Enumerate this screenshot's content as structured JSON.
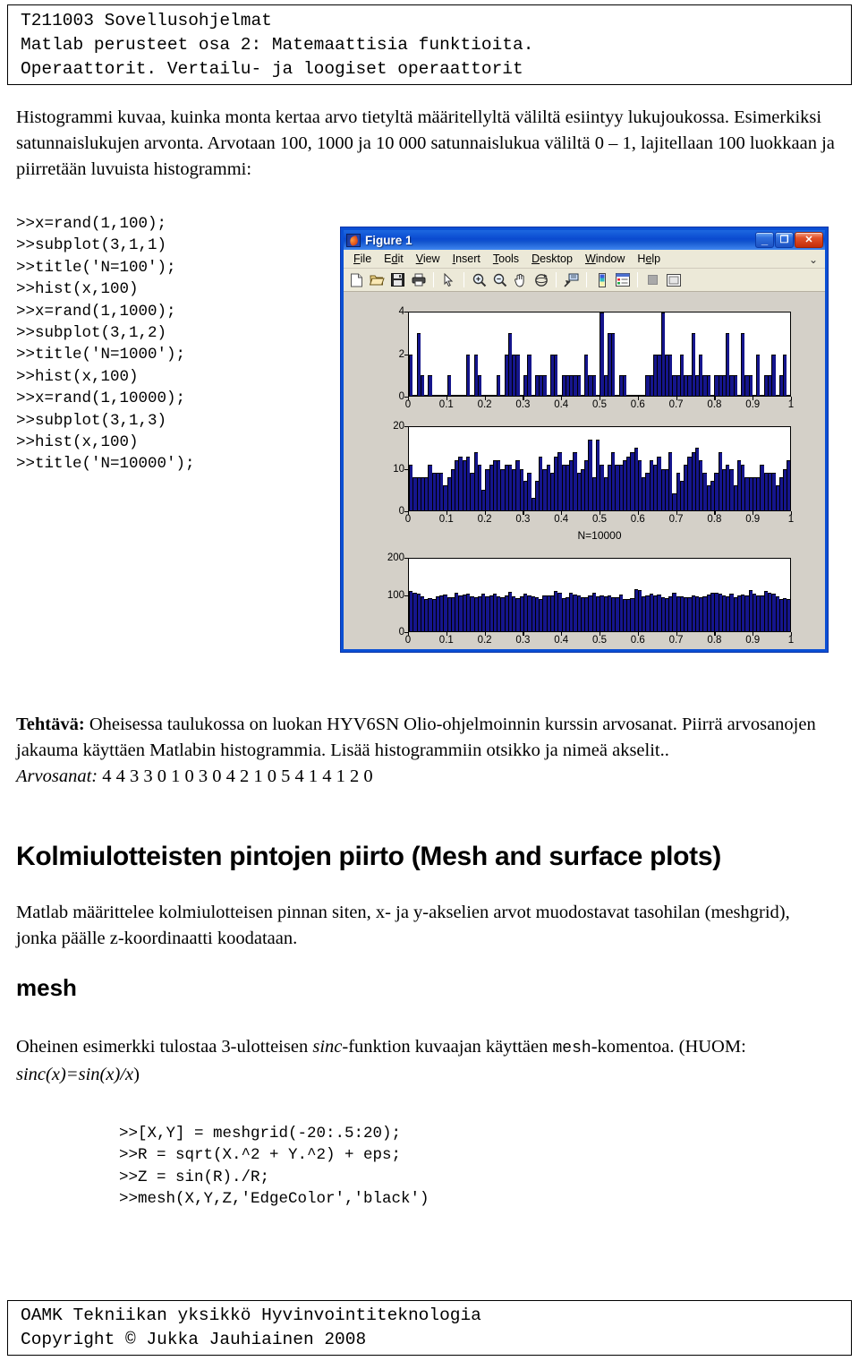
{
  "header": {
    "line1": "T211003 Sovellusohjelmat",
    "line2": "Matlab perusteet osa 2: Matemaattisia funktioita.",
    "line3": "Operaattorit. Vertailu- ja loogiset operaattorit"
  },
  "intro": {
    "text": "Histogrammi kuvaa, kuinka monta kertaa arvo tietyltä määritellyltä väliltä esiintyy lukujoukossa. Esimerkiksi satunnaislukujen arvonta. Arvotaan 100, 1000 ja 10 000 satunnaislukua väliltä 0 – 1, lajitellaan 100 luokkaan ja piirretään luvuista histogrammi:"
  },
  "code_block_1": {
    "text": ">>x=rand(1,100);\n>>subplot(3,1,1)\n>>title('N=100');\n>>hist(x,100)\n>>x=rand(1,1000);\n>>subplot(3,1,2)\n>>title('N=1000');\n>>hist(x,100)\n>>x=rand(1,10000);\n>>subplot(3,1,3)\n>>hist(x,100)\n>>title('N=10000');"
  },
  "figure_window": {
    "title": "Figure 1",
    "icon": "matlab-icon",
    "window_buttons": [
      {
        "name": "minimize-button",
        "glyph": "_"
      },
      {
        "name": "maximize-button",
        "glyph": "❐"
      },
      {
        "name": "close-button",
        "glyph": "✕"
      }
    ],
    "menu": [
      {
        "label": "File",
        "accel": "F"
      },
      {
        "label": "Edit",
        "accel": "E"
      },
      {
        "label": "View",
        "accel": "V"
      },
      {
        "label": "Insert",
        "accel": "I"
      },
      {
        "label": "Tools",
        "accel": "T"
      },
      {
        "label": "Desktop",
        "accel": "D"
      },
      {
        "label": "Window",
        "accel": "W"
      },
      {
        "label": "Help",
        "accel": "H"
      }
    ],
    "menu_overflow": "⌄",
    "toolbar": [
      {
        "name": "new-figure-icon"
      },
      {
        "name": "open-file-icon"
      },
      {
        "name": "save-figure-icon"
      },
      {
        "name": "print-figure-icon"
      },
      {
        "name": "separator"
      },
      {
        "name": "edit-plot-pointer-icon"
      },
      {
        "name": "separator"
      },
      {
        "name": "zoom-in-icon"
      },
      {
        "name": "zoom-out-icon"
      },
      {
        "name": "pan-icon"
      },
      {
        "name": "rotate-3d-icon"
      },
      {
        "name": "separator"
      },
      {
        "name": "data-cursor-icon"
      },
      {
        "name": "separator"
      },
      {
        "name": "insert-colorbar-icon"
      },
      {
        "name": "insert-legend-icon"
      },
      {
        "name": "separator"
      },
      {
        "name": "hide-plot-tools-icon"
      },
      {
        "name": "show-plot-tools-icon"
      }
    ]
  },
  "chart_data": [
    {
      "type": "bar",
      "title": "",
      "xlabel": "",
      "ylabel": "",
      "xlim": [
        0,
        1
      ],
      "ylim": [
        0,
        4
      ],
      "xticks": [
        "0",
        "0.1",
        "0.2",
        "0.3",
        "0.4",
        "0.5",
        "0.6",
        "0.7",
        "0.8",
        "0.9",
        "1"
      ],
      "yticks": [
        "0",
        "2",
        "4"
      ],
      "bin_count": 100,
      "values": [
        2,
        0,
        3,
        1,
        0,
        1,
        0,
        0,
        0,
        0,
        1,
        0,
        0,
        0,
        0,
        2,
        0,
        2,
        1,
        0,
        0,
        0,
        0,
        1,
        0,
        2,
        3,
        2,
        2,
        0,
        1,
        2,
        0,
        1,
        1,
        1,
        0,
        2,
        2,
        0,
        1,
        1,
        1,
        1,
        1,
        0,
        2,
        1,
        1,
        0,
        4,
        1,
        3,
        3,
        0,
        1,
        1,
        0,
        0,
        0,
        0,
        0,
        1,
        1,
        2,
        2,
        4,
        2,
        2,
        1,
        1,
        2,
        1,
        1,
        3,
        1,
        2,
        1,
        1,
        0,
        1,
        1,
        1,
        3,
        1,
        1,
        0,
        3,
        1,
        1,
        0,
        2,
        0,
        1,
        1,
        2,
        0,
        1,
        2,
        0
      ],
      "grid": false
    },
    {
      "type": "bar",
      "title": "",
      "xlabel": "N=10000",
      "ylabel": "",
      "xlim": [
        0,
        1
      ],
      "ylim": [
        0,
        20
      ],
      "xticks": [
        "0",
        "0.1",
        "0.2",
        "0.3",
        "0.4",
        "0.5",
        "0.6",
        "0.7",
        "0.8",
        "0.9",
        "1"
      ],
      "yticks": [
        "0",
        "10",
        "20"
      ],
      "bin_count": 100,
      "values": [
        11,
        8,
        8,
        8,
        8,
        11,
        9,
        9,
        9,
        6,
        8,
        10,
        12,
        13,
        12,
        13,
        9,
        14,
        11,
        5,
        10,
        11,
        12,
        12,
        10,
        11,
        11,
        10,
        12,
        10,
        7,
        9,
        3,
        7,
        13,
        10,
        11,
        9,
        13,
        14,
        11,
        11,
        12,
        14,
        9,
        10,
        12,
        17,
        8,
        17,
        11,
        8,
        11,
        14,
        11,
        11,
        12,
        13,
        14,
        15,
        12,
        8,
        9,
        12,
        11,
        13,
        10,
        10,
        14,
        4,
        9,
        7,
        11,
        13,
        14,
        15,
        12,
        9,
        6,
        7,
        9,
        14,
        10,
        11,
        10,
        6,
        12
      ],
      "grid": false
    },
    {
      "type": "bar",
      "title": "",
      "xlabel": "",
      "ylabel": "",
      "xlim": [
        0,
        1
      ],
      "ylim": [
        0,
        200
      ],
      "xticks": [
        "0",
        "0.1",
        "0.2",
        "0.3",
        "0.4",
        "0.5",
        "0.6",
        "0.7",
        "0.8",
        "0.9",
        "1"
      ],
      "yticks": [
        "0",
        "100",
        "200"
      ],
      "bin_count": 100,
      "values": [
        110,
        105,
        103,
        97,
        90,
        92,
        90,
        96,
        100,
        101,
        93,
        95,
        105,
        98,
        102,
        104,
        96,
        93,
        97,
        104,
        96,
        99,
        104,
        96,
        95,
        98,
        108,
        97,
        92,
        96,
        103,
        100,
        96,
        95,
        90,
        100,
        98,
        100,
        110,
        105,
        92,
        95,
        107,
        101,
        99,
        95,
        94,
        99,
        105,
        97,
        100,
        96,
        99,
        93,
        93,
        101,
        88,
        90,
        92,
        116,
        113,
        97,
        98,
        104,
        98,
        101,
        95,
        92,
        97,
        107,
        96,
        96,
        94,
        93,
        100,
        97,
        93,
        97,
        101,
        105,
        107,
        103,
        99,
        96,
        104,
        94,
        98,
        102,
        98,
        114,
        104,
        100,
        99
      ],
      "grid": false
    }
  ],
  "tehtava": {
    "bold_lead": "Tehtävä:",
    "body": " Oheisessa taulukossa on luokan HYV6SN Olio-ohjelmoinnin kurssin arvosanat. Piirrä arvosanojen jakauma käyttäen Matlabin histogrammia. Lisää histogrammiin otsikko ja nimeä akselit..",
    "arvosanat_label": "Arvosanat:",
    "arvosanat_values": " 4 4 3 3 0 1 0 3 0 4 2 1 0 5 4 1 4 1 2 0"
  },
  "section": {
    "heading": "Kolmiulotteisten pintojen piirto (Mesh and surface plots)",
    "paragraph": "Matlab määrittelee kolmiulotteisen pinnan siten, x- ja y-akselien arvot muodostavat tasohilan (meshgrid), jonka päälle z-koordinaatti koodataan.",
    "mesh_heading": "mesh",
    "sinc_part1": "Oheinen esimerkki tulostaa 3-ulotteisen ",
    "sinc_italic": "sinc",
    "sinc_part2": "-funktion kuvaajan käyttäen ",
    "sinc_mono": "mesh",
    "sinc_part3": "-komentoa. (HUOM: ",
    "sinc_formula": "sinc(x)=sin(x)/x",
    "sinc_part4": ")"
  },
  "code_block_2": {
    "text": ">>[X,Y] = meshgrid(-20:.5:20);\n>>R = sqrt(X.^2 + Y.^2) + eps;\n>>Z = sin(R)./R;\n>>mesh(X,Y,Z,'EdgeColor','black')"
  },
  "footer": {
    "line1": "OAMK Tekniikan yksikkö Hyvinvointiteknologia",
    "line2": "Copyright © Jukka Jauhiainen 2008"
  },
  "colors": {
    "bar_fill": "#15158c",
    "figure_bg": "#d4d0c8",
    "titlebar_blue": "#0a4fd4",
    "menubar": "#ece9d8"
  }
}
